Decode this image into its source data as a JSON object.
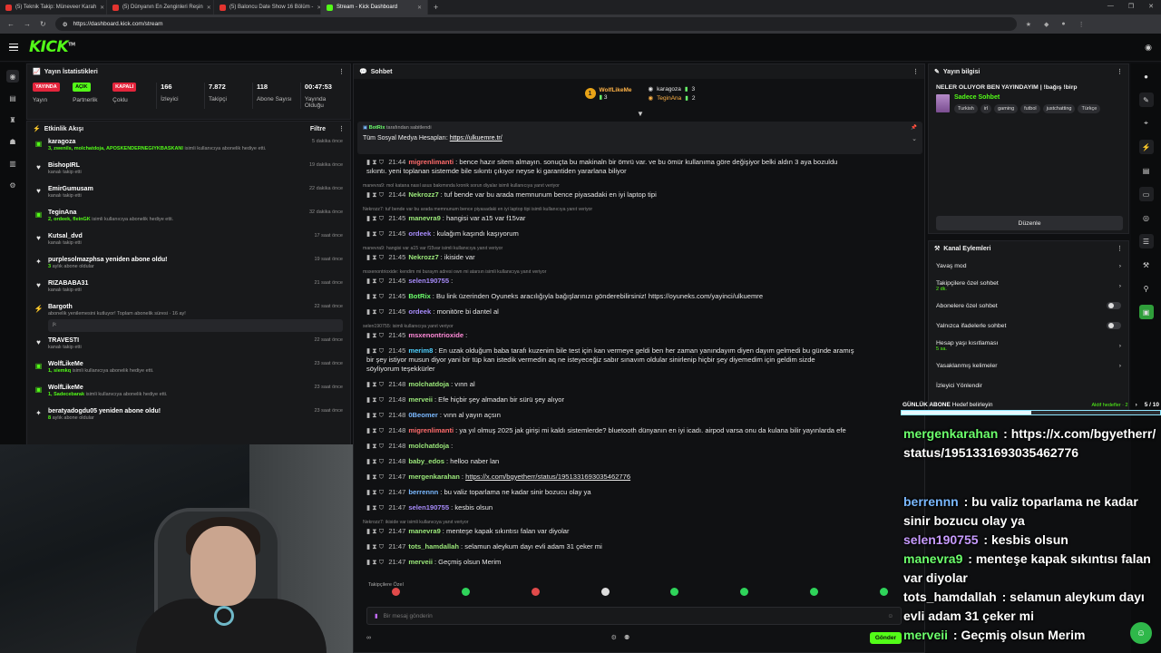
{
  "browser": {
    "tabs": [
      {
        "label": "(5) Teknik Takip: Müneveer Karah"
      },
      {
        "label": "(5) Dünyanın En Zenginleri Reşin"
      },
      {
        "label": "(5) Baloncu Date Show 16 Bölüm -"
      },
      {
        "label": "Stream - Kick Dashboard"
      }
    ],
    "url": "https://dashboard.kick.com/stream"
  },
  "header": {
    "logo": "KICK"
  },
  "stats": {
    "title": "Yayın İstatistikleri",
    "items": [
      {
        "badge": "YAYINDA",
        "label": "Yayın"
      },
      {
        "badge": "AÇIK",
        "label": "Partnerlik"
      },
      {
        "badge": "KAPALI",
        "label": "Çoklu"
      },
      {
        "value": "166",
        "label": "İzleyici"
      },
      {
        "value": "7.872",
        "label": "Takipçi"
      },
      {
        "value": "118",
        "label": "Abone Sayısı"
      },
      {
        "value": "00:47:53",
        "label": "Yayında Olduğu"
      }
    ]
  },
  "activity": {
    "title": "Etkinlik Akışı",
    "filter": "Filtre",
    "items": [
      {
        "icon": "gift",
        "name": "karagoza",
        "time": "5 dakika önce",
        "sub_hl": "3, zwenils, molchatdoja, APOSKENDERNEGIYKBASKANI",
        "sub": " isimli kullanıcıya abonelik hediye etti."
      },
      {
        "icon": "heart",
        "name": "BishopIRL",
        "time": "19 dakika önce",
        "sub_hl": "",
        "sub": "kanalı takip etti"
      },
      {
        "icon": "heart",
        "name": "EmirGumusam",
        "time": "22 dakika önce",
        "sub_hl": "",
        "sub": "kanalı takip etti"
      },
      {
        "icon": "gift",
        "name": "TeginAna",
        "time": "32 dakika önce",
        "sub_hl": "2, ordeek, fleinGK",
        "sub": " isimli kullanıcıya abonelik hediye etti."
      },
      {
        "icon": "heart",
        "name": "Kutsal_dvd",
        "time": "17 saat önce",
        "sub_hl": "",
        "sub": "kanalı takip etti"
      },
      {
        "icon": "star",
        "name": "purplesolmazphsa yeniden abone oldu!",
        "time": "19 saat önce",
        "sub_hl": "3",
        "sub": " aylık abone oldular"
      },
      {
        "icon": "heart",
        "name": "RIZABABA31",
        "time": "21 saat önce",
        "sub_hl": "",
        "sub": "kanalı takip etti"
      },
      {
        "icon": "bolt",
        "name": "Bargoth",
        "time": "22 saat önce",
        "sub_hl": "",
        "sub": "abonelik yenilemesini kutluyor! Toplam abonelik süresi · 16 ay!",
        "box": "jk"
      },
      {
        "icon": "heart",
        "name": "TRAVESTI",
        "time": "22 saat önce",
        "sub_hl": "",
        "sub": "kanalı takip etti"
      },
      {
        "icon": "gift",
        "name": "WolfLikeMe",
        "time": "23 saat önce",
        "sub_hl": "1, siemkq",
        "sub": " isimli kullanıcıya abonelik hediye etti."
      },
      {
        "icon": "gift",
        "name": "WolfLikeMe",
        "time": "23 saat önce",
        "sub_hl": "1, Sadecebarak",
        "sub": " isimli kullanıcıya abonelik hediye etti."
      },
      {
        "icon": "star",
        "name": "beratyadogdu05 yeniden abone oldu!",
        "time": "23 saat önce",
        "sub_hl": "8",
        "sub": " aylık abone oldular"
      }
    ]
  },
  "chat": {
    "title": "Sohbet",
    "top_donors": [
      {
        "name": "WolfLikeMe",
        "count": "3"
      },
      {
        "name": "karagoza",
        "count": "3"
      },
      {
        "name": "TeginAna",
        "count": "2"
      }
    ],
    "pinned": {
      "by_user": "BotRix",
      "by_suffix": "tarafından sabitlendi",
      "text": "Tüm Sosyal Medya Hesapları: ",
      "link": "https://ulkuemre.tr/"
    },
    "messages": [
      {
        "time": "21:44",
        "user": "migrenlimanti",
        "color": "c-red",
        "text": "bence hazır sitem almayın. sonuçta bu makinaln bir ömrü var. ve bu ömür kullanıma göre değişiyor belki aldın 3 aya bozuldu",
        "cont": "sıkıntı. yeni toplanan sistemde bile sıkıntı çıkıyor neyse ki garantiden yararlana biliyor"
      },
      {
        "reply": "manevra9: mol katana nasıl asus bakımında kronik sorun diyalar isimli kullanıcıya yanıt veriyor"
      },
      {
        "time": "21:44",
        "user": "Nekrozz7",
        "color": "c-lg",
        "text": "tuf bende var bu arada memnunum bence piyasadaki en iyi laptop tipi"
      },
      {
        "reply": "Nekrozz7: tuf bende var bu arada memnunum bence piyasadaki en iyi laptop tipi isimli kullanıcıya yanıt veriyor"
      },
      {
        "time": "21:45",
        "user": "manevra9",
        "color": "c-lg",
        "text": "hangisi var a15 var f15var"
      },
      {
        "time": "21:45",
        "user": "ordeek",
        "color": "c-pu",
        "text": "kulağım kaşındı kaşıyorum"
      },
      {
        "reply": "manevra9: hangisi var a15 var f15var isimli kullanıcıya yanıt veriyor"
      },
      {
        "time": "21:45",
        "user": "Nekrozz7",
        "color": "c-lg",
        "text": "ikiside var"
      },
      {
        "reply": "msxenontrioxide: kendim mi buraym adresi own mi atarsın isimli kullanıcıya yanıt veriyor"
      },
      {
        "time": "21:45",
        "user": "selen190755",
        "color": "c-pu",
        "text": ""
      },
      {
        "time": "21:45",
        "user": "BotRix",
        "color": "c-gr",
        "text": "Bu link üzerinden Oyuneks aracılığıyla bağışlarınızı gönderebilirsiniz! https://oyuneks.com/yayinci/ulkuemre"
      },
      {
        "time": "21:45",
        "user": "ordeek",
        "color": "c-pu",
        "text": "monitöre bi dantel al"
      },
      {
        "reply": "selen190755: isimli kullanıcıya yanıt veriyor"
      },
      {
        "time": "21:45",
        "user": "msxenontrioxide",
        "color": "c-pk",
        "text": ""
      },
      {
        "time": "21:45",
        "user": "merim8",
        "color": "c-cy",
        "text": "En uzak olduğum baba tarafı kuzenim bile test için kan vermeye geldi ben her zaman yanındayım diyen dayım gelmedi bu günde aramış",
        "cont": "bir şey istiyor musun diyor yani bir tüp kan istedik vermedin aq ne isteyeceğiz sabır sınavım oldular sinirlenip hiçbir şey diyemedim için geldim sizde",
        "cont2": "söyliyorum teşekkürler"
      },
      {
        "time": "21:48",
        "user": "molchatdoja",
        "color": "c-lg",
        "text": "vınn al"
      },
      {
        "time": "21:48",
        "user": "merveii",
        "color": "c-lg",
        "text": "Efe hiçbir şey almadan bir sürü şey alıyor"
      },
      {
        "time": "21:48",
        "user": "0Beomer",
        "color": "c-bl",
        "text": "vınn al yayın açsın"
      },
      {
        "time": "21:48",
        "user": "migrenlimanti",
        "color": "c-red",
        "text": "ya yıl olmuş 2025 jak girişi mi kaldı sistemlerde? bluetooth dünyanın en iyi icadı. airpod varsa onu da kulana bilir yayınlarda efe"
      },
      {
        "time": "21:48",
        "user": "molchatdoja",
        "color": "c-lg",
        "text": ""
      },
      {
        "time": "21:48",
        "user": "baby_edos",
        "color": "c-lg",
        "text": "helloo naber lan"
      },
      {
        "time": "21:47",
        "user": "mergenkarahan",
        "color": "c-lg",
        "link": "https://x.com/bgyetherr/status/1951331693035462776"
      },
      {
        "time": "21:47",
        "user": "berrennn",
        "color": "c-bl",
        "text": "bu valiz toparlama ne kadar sinir bozucu olay ya"
      },
      {
        "time": "21:47",
        "user": "selen190755",
        "color": "c-pu",
        "text": "kesbis olsun"
      },
      {
        "reply": "Nekrozz7: ikiside var isimli kullanıcıya yanıt veriyor"
      },
      {
        "time": "21:47",
        "user": "manevra9",
        "color": "c-lg",
        "text": "menteşe kapak sıkıntısı falan var diyolar"
      },
      {
        "time": "21:47",
        "user": "tots_hamdallah",
        "color": "c-lg",
        "text": "selamun aleykum dayı evli adam 31 çeker mi"
      },
      {
        "time": "21:47",
        "user": "merveii",
        "color": "c-lg",
        "text": "Geçmiş olsun Merim"
      }
    ],
    "sub_only_label": "Takipçilere Özel",
    "input_placeholder": "Bir mesaj gönderin",
    "send_label": "Gönder"
  },
  "stream_info": {
    "title": "Yayın bilgisi",
    "stream_title": "NELER OLUYOR BEN YAYINDAYIM | !bağış !birp",
    "category": "Sadece Sohbet",
    "tags": [
      "Turkish",
      "irl",
      "gaming",
      "futbol",
      "justchatting",
      "Türkçe"
    ],
    "edit_label": "Düzenle"
  },
  "channel_actions": {
    "title": "Kanal Eylemleri",
    "rows": [
      {
        "label": "Yavaş mod",
        "type": "chevron"
      },
      {
        "label": "Takipçilere özel sohbet",
        "sub": "2 dk.",
        "type": "chevron"
      },
      {
        "label": "Abonelere özel sohbet",
        "type": "toggle"
      },
      {
        "label": "Yalnızca ifadelerle sohbet",
        "type": "toggle"
      },
      {
        "label": "Hesap yaşı kısıtlaması",
        "sub": "5 sa.",
        "type": "chevron"
      },
      {
        "label": "Yasaklanmış kelimeler",
        "type": "chevron"
      },
      {
        "label": "İzleyici Yönlendir",
        "type": "none"
      }
    ]
  },
  "goal": {
    "label": "GÜNLÜK ABONE",
    "sub": "Hedef belirleyin",
    "active": "Aktif hedefler · 2",
    "count": "5 / 10",
    "progress": 0.5
  },
  "overlay_chat": [
    {
      "user": "mergenkarahan",
      "color": "#6cff6c",
      "text": "https://x.com/bgyetherr/status/1951331693035462776"
    },
    {
      "user": "berrennn",
      "color": "#7ab8ff",
      "text": "bu valiz toparlama ne kadar sinir bozucu olay ya"
    },
    {
      "user": "selen190755",
      "color": "#c79bff",
      "text": "kesbis olsun"
    },
    {
      "user": "manevra9",
      "color": "#6cff6c",
      "text": "menteşe kapak sıkıntısı falan var diyolar"
    },
    {
      "user": "tots_hamdallah",
      "color": "#ffffff",
      "text": "selamun aleykum dayı evli adam 31 çeker mi"
    },
    {
      "user": "merveii",
      "color": "#6cff6c",
      "text": "Geçmiş olsun Merim"
    }
  ]
}
